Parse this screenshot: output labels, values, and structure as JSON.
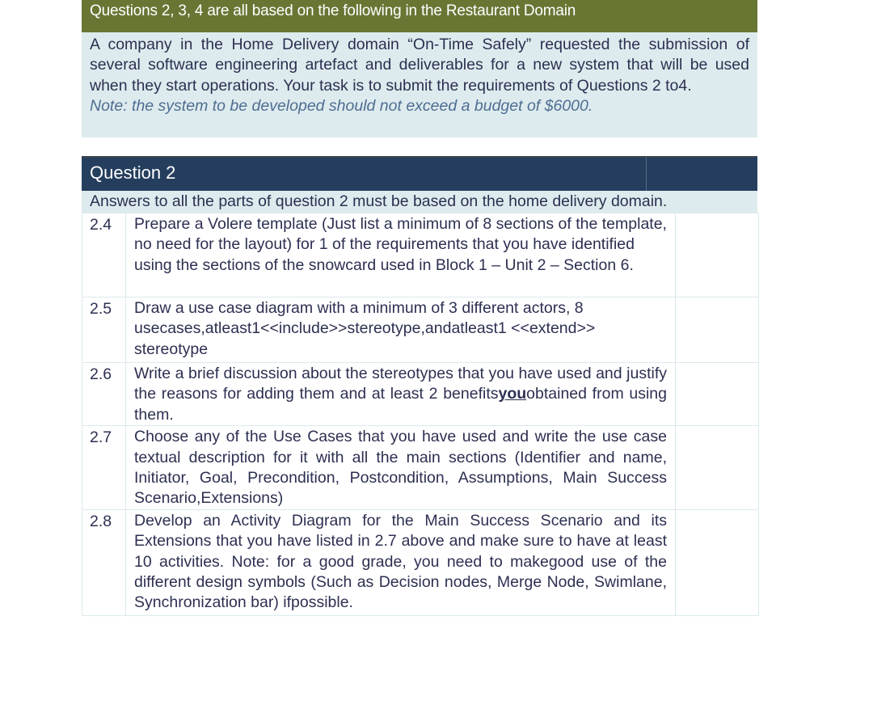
{
  "banner": {
    "title": "Questions 2, 3, 4 are all based on the following in the Restaurant Domain"
  },
  "intro": {
    "paragraph": "A company in the Home Delivery domain “On-Time Safely” requested the submission of several software engineering artefact and deliverables for a new system that will be used when they start operations. Your task is to submit the requirements of Questions 2 to4.",
    "note": "Note: the system to be developed should not exceed a budget of $6000."
  },
  "colors": {
    "banner_bg": "#687634",
    "intro_bg": "#deebee",
    "question_header_bg": "#253e5e",
    "note_text": "#4e6d92",
    "body_text": "#2c3051"
  },
  "question": {
    "title": "Question 2",
    "subtitle": "Answers to all the parts of question 2 must be based on the home delivery domain.",
    "parts": [
      {
        "number": "2.4",
        "text": "Prepare a Volere template (Just list a minimum of 8 sections of the template, no need for the layout) for 1 of the requirements that you have identified using the sections of the snowcard used in Block 1 – Unit 2 – Section 6."
      },
      {
        "number": "2.5",
        "text": "Draw a use case diagram with a minimum of 3 different actors, 8 usecases,atleast1<<include>>stereotype,andatleast1 <<extend>> stereotype"
      },
      {
        "number": "2.6",
        "text_before": "Write a brief discussion about the stereotypes that you have used and justify the reasons for adding them and at least 2 benefits",
        "text_emphasis": "you",
        "text_after": "obtained from using them."
      },
      {
        "number": "2.7",
        "text": "Choose any of the Use Cases that you have used and write the use case textual description for it with all the main sections (Identifier and name, Initiator, Goal, Precondition, Postcondition,  Assumptions, Main Success Scenario,Extensions)"
      },
      {
        "number": "2.8",
        "text": "Develop an Activity Diagram for the Main Success Scenario and its Extensions that you have listed in 2.7 above and make sure to have at least 10 activities. Note: for a good grade, you need to makegood use of the different design symbols (Such as Decision nodes, Merge Node, Swimlane, Synchronization bar) ifpossible."
      }
    ]
  }
}
